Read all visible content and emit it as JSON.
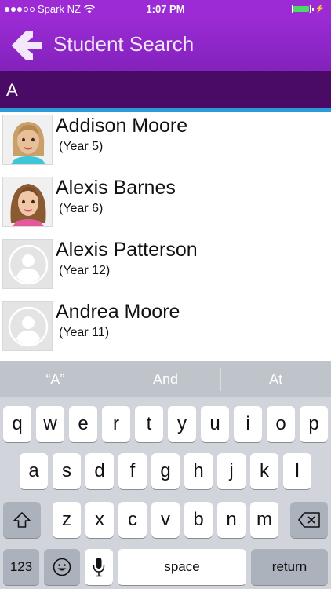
{
  "status_bar": {
    "carrier": "Spark NZ",
    "time": "1:07 PM",
    "signal_bars": 3,
    "battery_level": 1.0,
    "icons": [
      "wifi-icon",
      "battery-icon",
      "charging-icon"
    ]
  },
  "nav": {
    "title": "Student Search",
    "back_icon": "back-arrow-icon"
  },
  "search": {
    "value": "A"
  },
  "students": [
    {
      "name": "Addison Moore",
      "year": "(Year 5)",
      "avatar": "girl-blonde-avatar"
    },
    {
      "name": "Alexis Barnes",
      "year": "(Year 6)",
      "avatar": "girl-brown-hair-avatar"
    },
    {
      "name": "Alexis Patterson",
      "year": "(Year 12)",
      "avatar": "default-person-avatar"
    },
    {
      "name": "Andrea Moore",
      "year": "(Year 11)",
      "avatar": "default-person-avatar"
    }
  ],
  "keyboard": {
    "suggestions": [
      "“A”",
      "And",
      "At"
    ],
    "row1": [
      "q",
      "w",
      "e",
      "r",
      "t",
      "y",
      "u",
      "i",
      "o",
      "p"
    ],
    "row2": [
      "a",
      "s",
      "d",
      "f",
      "g",
      "h",
      "j",
      "k",
      "l"
    ],
    "row3": [
      "z",
      "x",
      "c",
      "v",
      "b",
      "n",
      "m"
    ],
    "numbers_label": "123",
    "space_label": "space",
    "return_label": "return",
    "icons": [
      "shift-icon",
      "backspace-icon",
      "emoji-icon",
      "microphone-icon"
    ]
  },
  "colors": {
    "nav_purple": "#9a2bd4",
    "search_bar": "#4a0b66",
    "accent_blue": "#2a9dd8",
    "battery_green": "#4cd964"
  }
}
